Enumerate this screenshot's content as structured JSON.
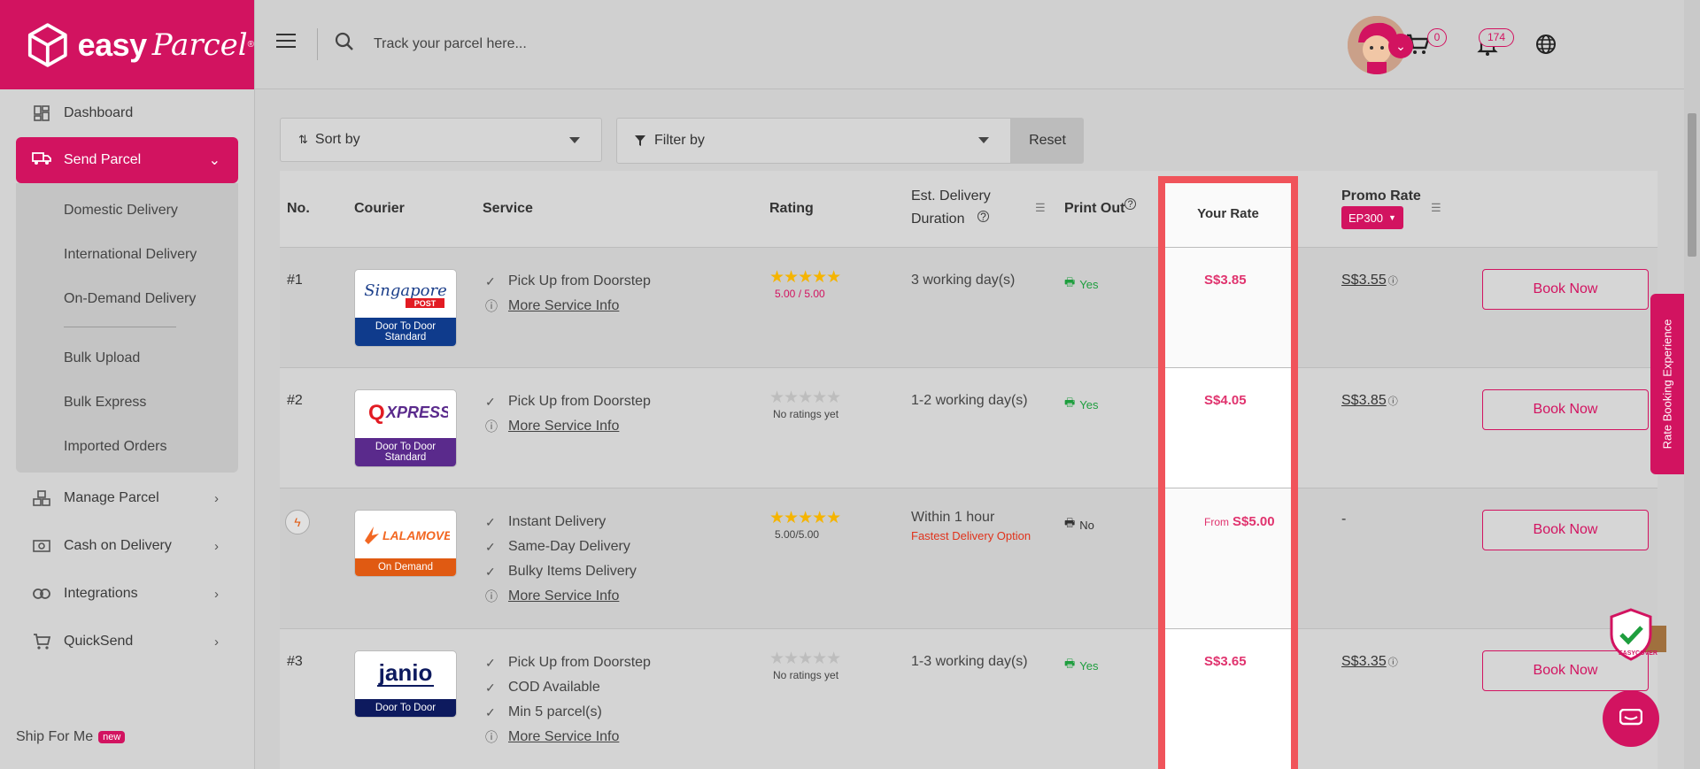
{
  "brand": {
    "name_part1": "easy",
    "name_part2": "Parcel",
    "reg": "®",
    "accent": "#d21360"
  },
  "sidebar": {
    "dashboard": "Dashboard",
    "send_parcel": "Send Parcel",
    "send_sub": [
      "Domestic Delivery",
      "International Delivery",
      "On-Demand Delivery"
    ],
    "send_sub2": [
      "Bulk Upload",
      "Bulk Express",
      "Imported Orders"
    ],
    "manage_parcel": "Manage Parcel",
    "cod": "Cash on Delivery",
    "integrations": "Integrations",
    "quicksend": "QuickSend",
    "ship_for_me": "Ship For Me",
    "new_badge": "new"
  },
  "topbar": {
    "search_placeholder": "Track your parcel here...",
    "cart_count": "0",
    "notif_count": "174"
  },
  "toolbar": {
    "sort": "Sort by",
    "filter": "Filter by",
    "reset": "Reset"
  },
  "table": {
    "headers": {
      "no": "No.",
      "courier": "Courier",
      "service": "Service",
      "rating": "Rating",
      "est1": "Est. Delivery",
      "est2": "Duration",
      "print": "Print Out",
      "your_rate": "Your Rate",
      "promo_rate": "Promo Rate",
      "promo_code": "EP300"
    },
    "rows": [
      {
        "no": "#1",
        "courier_logo": "Singapore POST",
        "tag": "Door To Door Standard",
        "tag_color": "#0f3b8c",
        "services": [
          "Pick Up from Doorstep"
        ],
        "more": "More Service Info",
        "rating": "5.00 / 5.00",
        "rated": true,
        "est": "3 working day(s)",
        "est_note": "",
        "print": "Yes",
        "rate_prefix": "",
        "rate": "S$3.85",
        "promo": "S$3.55",
        "book": "Book Now"
      },
      {
        "no": "#2",
        "courier_logo": "QXPRESS",
        "tag": "Door To Door Standard",
        "tag_color": "#5a2a8c",
        "services": [
          "Pick Up from Doorstep"
        ],
        "more": "More Service Info",
        "rating": "No ratings yet",
        "rated": false,
        "est": "1-2 working day(s)",
        "est_note": "",
        "print": "Yes",
        "rate_prefix": "",
        "rate": "S$4.05",
        "promo": "S$3.85",
        "book": "Book Now"
      },
      {
        "no": "",
        "courier_logo": "LALAMOVE",
        "tag": "On Demand",
        "tag_color": "#e05a12",
        "services": [
          "Instant Delivery",
          "Same-Day Delivery",
          "Bulky Items Delivery"
        ],
        "more": "More Service Info",
        "rating": "5.00/5.00",
        "rated": true,
        "est": "Within 1 hour",
        "est_note": "Fastest Delivery Option",
        "print": "No",
        "rate_prefix": "From",
        "rate": "S$5.00",
        "promo": "-",
        "book": "Book Now"
      },
      {
        "no": "#3",
        "courier_logo": "janio",
        "tag": "Door To Door",
        "tag_color": "#0d1a5e",
        "services": [
          "Pick Up from Doorstep",
          "COD Available",
          "Min 5 parcel(s)"
        ],
        "more": "More Service Info",
        "rating": "No ratings yet",
        "rated": false,
        "est": "1-3 working day(s)",
        "est_note": "",
        "print": "Yes",
        "rate_prefix": "",
        "rate": "S$3.65",
        "promo": "S$3.35",
        "book": "Book Now"
      }
    ]
  },
  "floating": {
    "rate_booking": "Rate Booking Experience",
    "easycover": "EASYCOVER"
  }
}
